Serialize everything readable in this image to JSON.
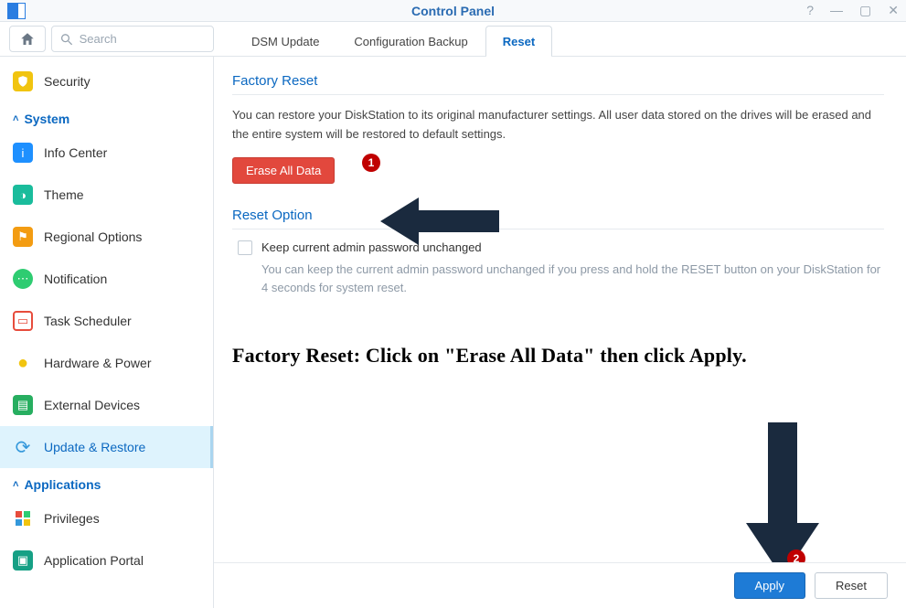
{
  "window": {
    "title": "Control Panel"
  },
  "search": {
    "placeholder": "Search"
  },
  "tabs": [
    {
      "label": "DSM Update",
      "active": false
    },
    {
      "label": "Configuration Backup",
      "active": false
    },
    {
      "label": "Reset",
      "active": true
    }
  ],
  "sidebar": {
    "top_item": "Security",
    "groups": [
      {
        "header": "System",
        "items": [
          {
            "label": "Info Center",
            "color": "#1e90ff",
            "glyph": "i"
          },
          {
            "label": "Theme",
            "color": "#1abc9c",
            "glyph": "◑"
          },
          {
            "label": "Regional Options",
            "color": "#f39c12",
            "glyph": "⚑"
          },
          {
            "label": "Notification",
            "color": "#2ecc71",
            "glyph": "⋯"
          },
          {
            "label": "Task Scheduler",
            "color": "#e74c3c",
            "glyph": "▭"
          },
          {
            "label": "Hardware & Power",
            "color": "#f1c40f",
            "glyph": "●"
          },
          {
            "label": "External Devices",
            "color": "#27ae60",
            "glyph": "▤"
          },
          {
            "label": "Update & Restore",
            "color": "#3498db",
            "glyph": "⟳",
            "active": true
          }
        ]
      },
      {
        "header": "Applications",
        "items": [
          {
            "label": "Privileges",
            "color": "#e74c3c",
            "glyph": "▦"
          },
          {
            "label": "Application Portal",
            "color": "#16a085",
            "glyph": "▣"
          }
        ]
      }
    ]
  },
  "main": {
    "factory_reset_title": "Factory Reset",
    "factory_reset_desc": "You can restore your DiskStation to its original manufacturer settings. All user data stored on the drives will be erased and the entire system will be restored to default settings.",
    "erase_button": "Erase All Data",
    "reset_option_title": "Reset Option",
    "checkbox_label": "Keep current admin password unchanged",
    "checkbox_hint": "You can keep the current admin password unchanged if you press and hold the RESET button on your DiskStation for 4 seconds for system reset.",
    "instruction": "Factory Reset: Click on \"Erase All Data\" then click Apply.",
    "footer": {
      "apply": "Apply",
      "reset": "Reset"
    },
    "badges": {
      "one": "1",
      "two": "2"
    }
  }
}
